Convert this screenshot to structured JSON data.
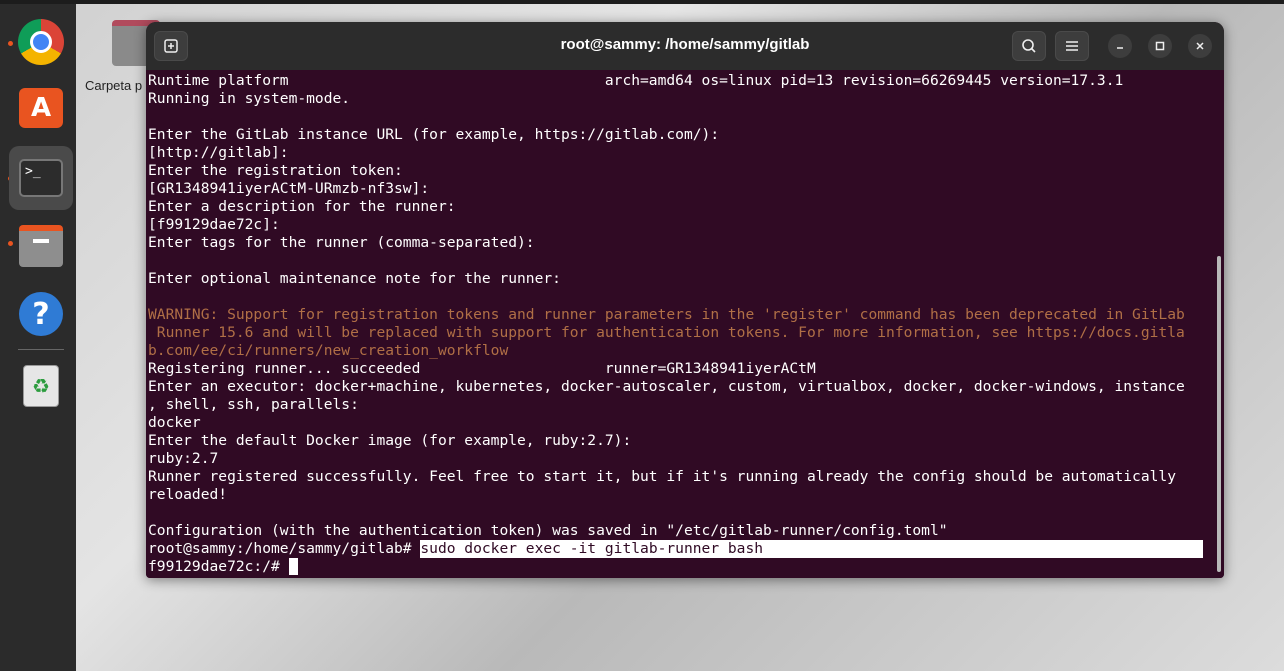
{
  "window": {
    "title": "root@sammy: /home/sammy/gitlab"
  },
  "desktop": {
    "folder_label": "Carpeta p"
  },
  "dock": {
    "items": [
      {
        "name": "chrome-icon",
        "label": "Google Chrome"
      },
      {
        "name": "software-icon",
        "label": "Ubuntu Software"
      },
      {
        "name": "terminal-icon",
        "label": "Terminal"
      },
      {
        "name": "files-icon",
        "label": "Files"
      },
      {
        "name": "help-icon",
        "label": "Help"
      },
      {
        "name": "trash-icon",
        "label": "Trash"
      }
    ],
    "terminal_glyph": ">_",
    "software_glyph": "A",
    "help_glyph": "?",
    "trash_glyph": "♻"
  },
  "colors": {
    "terminal_bg": "#300a24",
    "warning_text": "#b06f46",
    "accent": "#e95420"
  },
  "terminal": {
    "lines": [
      "Runtime platform                                    arch=amd64 os=linux pid=13 revision=66269445 version=17.3.1",
      "Running in system-mode.",
      "",
      "Enter the GitLab instance URL (for example, https://gitlab.com/):",
      "[http://gitlab]:",
      "Enter the registration token:",
      "[GR1348941iyerACtM-URmzb-nf3sw]:",
      "Enter a description for the runner:",
      "[f99129dae72c]:",
      "Enter tags for the runner (comma-separated):",
      "",
      "Enter optional maintenance note for the runner:",
      "",
      "WARNING: Support for registration tokens and runner parameters in the 'register' command has been deprecated in GitLab",
      " Runner 15.6 and will be replaced with support for authentication tokens. For more information, see https://docs.gitla",
      "b.com/ee/ci/runners/new_creation_workflow",
      "Registering runner... succeeded                     runner=GR1348941iyerACtM",
      "Enter an executor: docker+machine, kubernetes, docker-autoscaler, custom, virtualbox, docker, docker-windows, instance",
      ", shell, ssh, parallels:",
      "docker",
      "Enter the default Docker image (for example, ruby:2.7):",
      "ruby:2.7",
      "Runner registered successfully. Feel free to start it, but if it's running already the config should be automatically",
      "reloaded!",
      "",
      "Configuration (with the authentication token) was saved in \"/etc/gitlab-runner/config.toml\""
    ],
    "prompt1": "root@sammy:/home/sammy/gitlab# ",
    "command1": "sudo docker exec -it gitlab-runner bash",
    "prompt2": "f99129dae72c:/# "
  }
}
